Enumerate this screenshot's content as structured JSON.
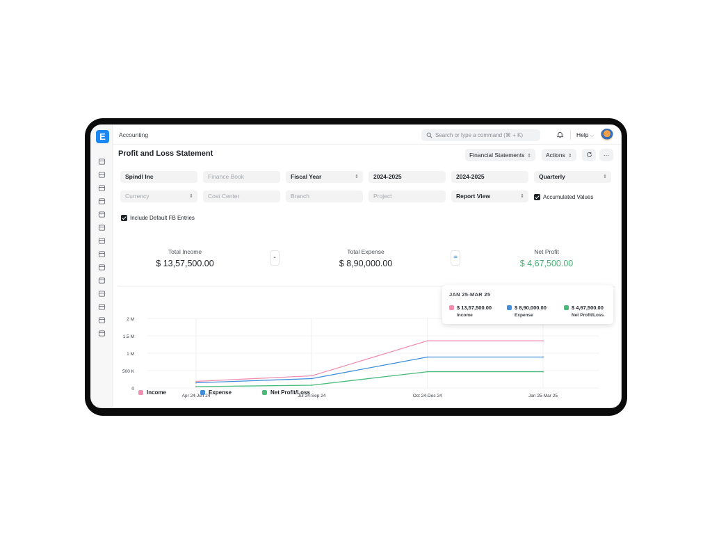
{
  "app": {
    "logo_letter": "E",
    "breadcrumb": "Accounting"
  },
  "topbar": {
    "search_placeholder": "Search or type a command (⌘ + K)",
    "help_label": "Help",
    "search_icon": "search-icon",
    "bell_icon": "bell-icon"
  },
  "sidebar": {
    "icons": [
      "tools-icon",
      "calendar-icon",
      "briefcase-icon",
      "wallet-icon",
      "shopping-bag-icon",
      "cube-icon",
      "pie-chart-icon",
      "building-icon",
      "shield-icon",
      "folder-icon",
      "database-icon",
      "database-icon",
      "link-icon",
      "headset-icon"
    ]
  },
  "page": {
    "title": "Profit and Loss Statement",
    "financial_statements_label": "Financial Statements",
    "actions_label": "Actions",
    "refresh_icon": "refresh-icon",
    "more_label": "···"
  },
  "filters": {
    "company": "Spindl Inc",
    "finance_book": "Finance Book",
    "period_type": "Fiscal Year",
    "from_year": "2024-2025",
    "to_year": "2024-2025",
    "periodicity": "Quarterly",
    "currency": "Currency",
    "cost_center": "Cost Center",
    "branch": "Branch",
    "project": "Project",
    "report_view": "Report View",
    "accumulated_values_label": "Accumulated Values",
    "accumulated_values_checked": true,
    "include_default_fb_label": "Include Default FB Entries",
    "include_default_fb_checked": true
  },
  "summary": {
    "income_label": "Total Income",
    "income_value": "$ 13,57,500.00",
    "minus_op": "-",
    "expense_label": "Total Expense",
    "expense_value": "$ 8,90,000.00",
    "equals_op": "=",
    "profit_label": "Net Profit",
    "profit_value": "$ 4,67,500.00"
  },
  "tooltip": {
    "title": "JAN 25-MAR 25",
    "items": [
      {
        "value": "$ 13,57,500.00",
        "name": "Income"
      },
      {
        "value": "$ 8,90,000.00",
        "name": "Expense"
      },
      {
        "value": "$ 4,67,500.00",
        "name": "Net Profit/Loss"
      }
    ]
  },
  "colors": {
    "income": "#f18fb1",
    "expense": "#3f8edb",
    "profit": "#48bb78",
    "accent": "#1b87f3"
  },
  "chart_data": {
    "type": "line",
    "categories": [
      "Apr 24-Jun 24",
      "Jul 24-Sep 24",
      "Oct 24-Dec 24",
      "Jan 25-Mar 25"
    ],
    "y_ticks": [
      "0",
      "500 K",
      "1 M",
      "1.5 M",
      "2 M"
    ],
    "ylim": [
      0,
      2000000
    ],
    "grid": true,
    "legend": "bottom-left",
    "series": [
      {
        "name": "Income",
        "values": [
          190000,
          350000,
          1357500,
          1357500
        ]
      },
      {
        "name": "Expense",
        "values": [
          150000,
          270000,
          890000,
          890000
        ]
      },
      {
        "name": "Net Profit/Loss",
        "values": [
          40000,
          80000,
          467500,
          467500
        ]
      }
    ]
  }
}
